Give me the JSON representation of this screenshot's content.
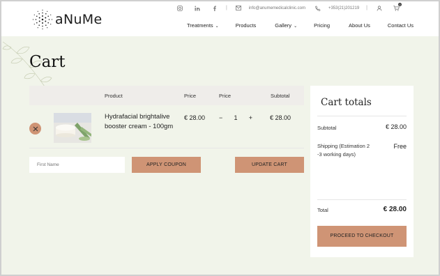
{
  "brand": {
    "name": "aNuMe"
  },
  "topbar": {
    "email": "info@anumemedicalclinic.com",
    "phone": "+353(21)201219",
    "cart_count": "0"
  },
  "nav": [
    {
      "label": "Treatments",
      "has_dropdown": true
    },
    {
      "label": "Products",
      "has_dropdown": false
    },
    {
      "label": "Gallery",
      "has_dropdown": true
    },
    {
      "label": "Pricing",
      "has_dropdown": false
    },
    {
      "label": "About Us",
      "has_dropdown": false
    },
    {
      "label": "Contact Us",
      "has_dropdown": false
    }
  ],
  "page": {
    "title": "Cart"
  },
  "cart": {
    "headers": {
      "product": "Product",
      "price": "Price",
      "quantity": "Price",
      "subtotal": "Subtotal"
    },
    "item": {
      "name": "Hydrafacial brightalive booster cream - 100gm",
      "price": "€ 28.00",
      "qty_minus": "−",
      "qty": "1",
      "qty_plus": "+",
      "subtotal": "€ 28.00"
    },
    "coupon_placeholder": "First Name",
    "apply_label": "APPLY COUPON",
    "update_label": "UPDATE CART"
  },
  "totals": {
    "title": "Cart totals",
    "subtotal_label": "Subtotal",
    "subtotal_value": "€ 28.00",
    "shipping_label": "Shipping (Estimation 2 -3 working days)",
    "shipping_value": "Free",
    "total_label": "Total",
    "total_value": "€ 28.00",
    "checkout_label": "PROCEED TO CHECKOUT"
  },
  "colors": {
    "accent": "#cf9475",
    "page_bg": "#f1f4ea",
    "header_bg": "#efedea"
  }
}
